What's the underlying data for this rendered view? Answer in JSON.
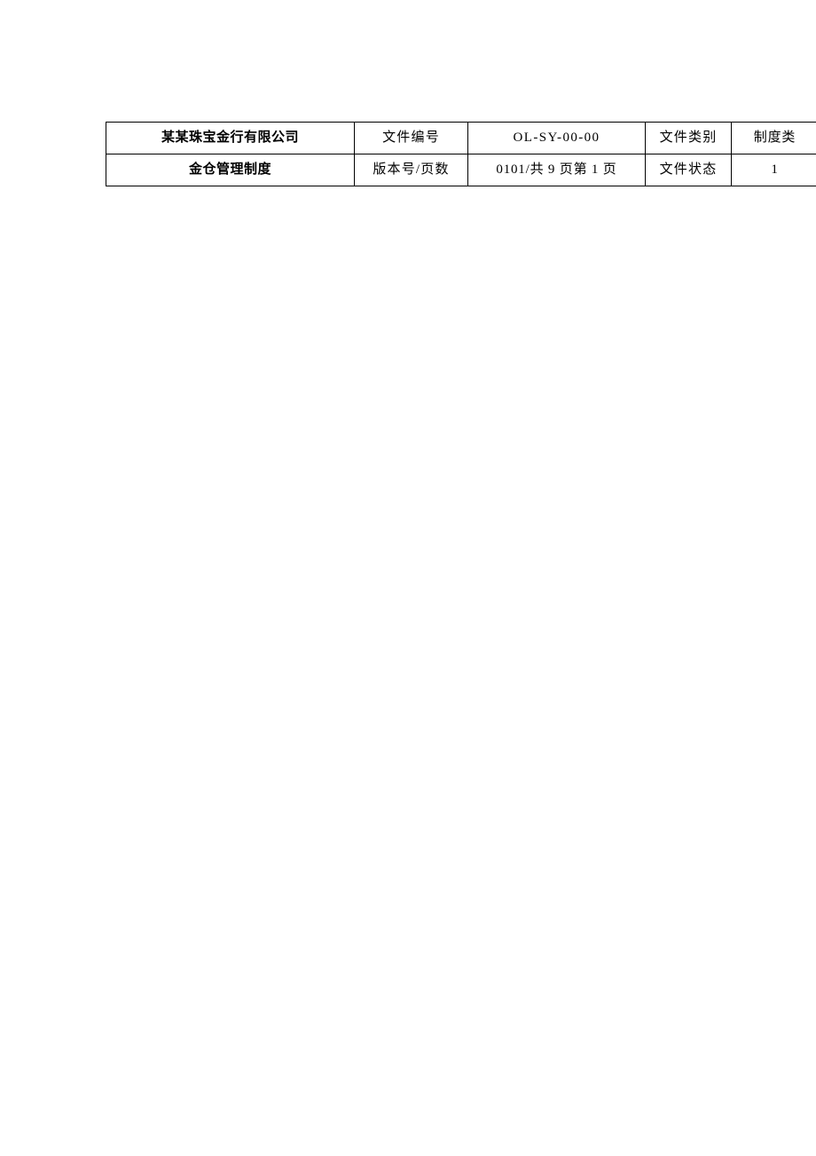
{
  "document": {
    "page_background": "#ffffff",
    "accent_color": "#0000ff",
    "text_color": "#000000",
    "border_color": "#000000"
  },
  "header_table": {
    "rows": [
      {
        "company_name": "某某珠宝金行有限公司",
        "doc_number_label": "文件编号",
        "doc_number_value": "OL-SY-00-00",
        "doc_category_label": "文件类别",
        "doc_category_value": "制度类"
      },
      {
        "doc_title": "金仓管理制度",
        "version_label": "版本号/页数",
        "version_value": "0101/共 9 页第 1 页",
        "doc_status_label": "文件状态",
        "doc_status_value": "1"
      }
    ]
  },
  "body": {
    "content": ""
  }
}
